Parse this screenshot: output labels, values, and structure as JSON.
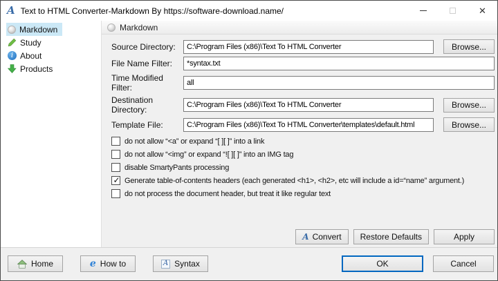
{
  "window": {
    "title": "Text to HTML Converter-Markdown By https://software-download.name/",
    "close_glyph": "✕"
  },
  "sidebar": {
    "items": [
      {
        "label": "Markdown",
        "selected": true
      },
      {
        "label": "Study",
        "selected": false
      },
      {
        "label": "About",
        "selected": false
      },
      {
        "label": "Products",
        "selected": false
      }
    ]
  },
  "panel": {
    "header": "Markdown",
    "fields": [
      {
        "label": "Source Directory:",
        "value": "C:\\Program Files (x86)\\Text To HTML Converter",
        "browse": "Browse..."
      },
      {
        "label": "File Name Filter:",
        "value": "*syntax.txt"
      },
      {
        "label": "Time Modified Filter:",
        "value": "all"
      },
      {
        "label": "Destination Directory:",
        "value": "C:\\Program Files (x86)\\Text To HTML Converter",
        "browse": "Browse..."
      },
      {
        "label": "Template File:",
        "value": "C:\\Program Files (x86)\\Text To HTML Converter\\templates\\default.html",
        "browse": "Browse..."
      }
    ],
    "checkboxes": [
      {
        "label": "do not allow “<a” or expand “[ ][ ]” into a link",
        "mark": ""
      },
      {
        "label": "do not allow “<img” or expand “![ ][ ]” into an IMG tag",
        "mark": ""
      },
      {
        "label": "disable SmartyPants processing",
        "mark": ""
      },
      {
        "label": "Generate table-of-contents headers (each generated <h1>, <h2>, etc will include a id=“name” argument.)",
        "mark": "✓"
      },
      {
        "label": "do not process the document header, but treat it like regular text",
        "mark": ""
      }
    ],
    "actions": {
      "convert": "Convert",
      "restore": "Restore Defaults",
      "apply": "Apply"
    }
  },
  "footer": {
    "home": "Home",
    "howto": "How to",
    "syntax": "Syntax",
    "ok": "OK",
    "cancel": "Cancel"
  },
  "colors": {
    "accent": "#0067c0",
    "selection": "#cbe8f6"
  }
}
